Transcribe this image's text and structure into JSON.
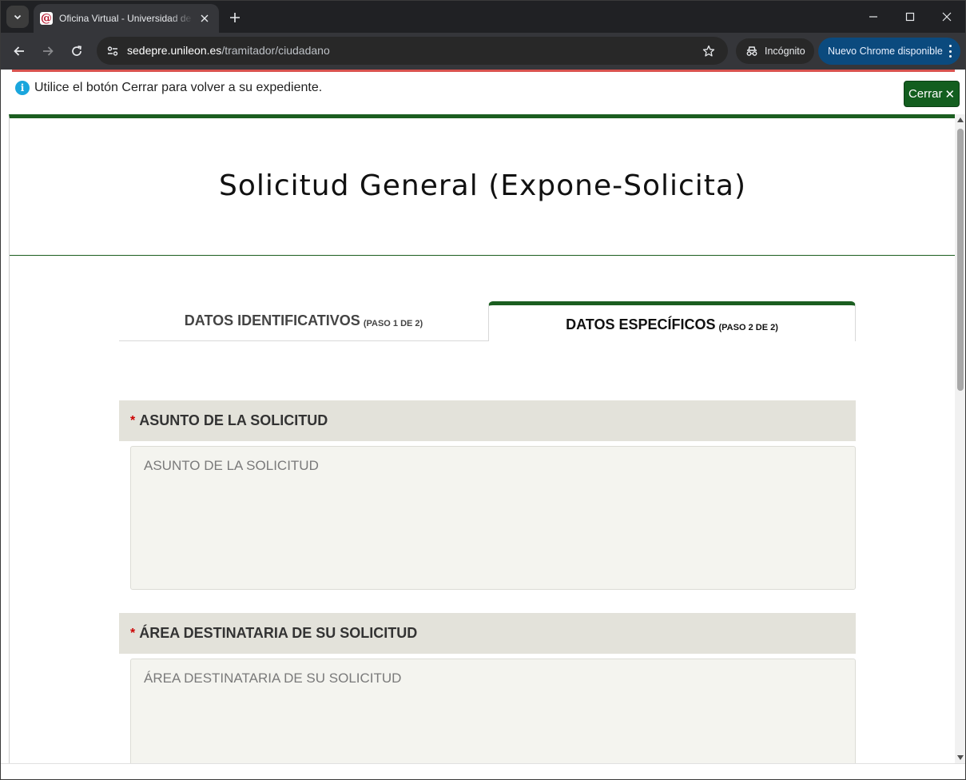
{
  "browser": {
    "tab_title": "Oficina Virtual - Universidad de León",
    "url_host": "sedepre.unileon.es",
    "url_path": "/tramitador/ciudadano",
    "incognito_label": "Incógnito",
    "update_label": "Nuevo Chrome disponible"
  },
  "notice": {
    "message": "Utilice el botón Cerrar para volver a su expediente.",
    "close_label": "Cerrar",
    "close_glyph": "✕"
  },
  "page": {
    "title": "Solicitud General (Expone-Solicita)"
  },
  "steps": [
    {
      "label": "DATOS IDENTIFICATIVOS",
      "sub": "(PASO 1 DE 2)",
      "active": false
    },
    {
      "label": "DATOS ESPECÍFICOS",
      "sub": "(PASO 2 DE 2)",
      "active": true
    }
  ],
  "sections": [
    {
      "required_mark": "*",
      "label": "ASUNTO DE LA SOLICITUD",
      "placeholder": "ASUNTO DE LA SOLICITUD",
      "value": ""
    },
    {
      "required_mark": "*",
      "label": "ÁREA DESTINATARIA DE SU SOLICITUD",
      "placeholder": "ÁREA DESTINATARIA DE SU SOLICITUD",
      "value": ""
    }
  ],
  "colors": {
    "brand_green": "#1b5e20",
    "close_button": "#135e1f",
    "section_header": "#e3e2da",
    "required": "#cc0000",
    "info_icon": "#1aa6dd"
  }
}
